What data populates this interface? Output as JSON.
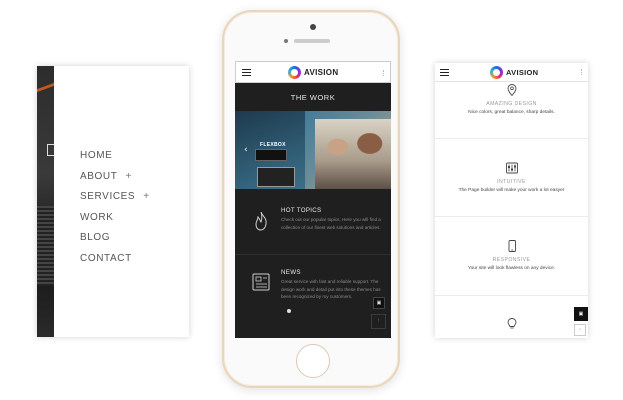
{
  "left_screen": {
    "menu": [
      {
        "label": "HOME",
        "expander": ""
      },
      {
        "label": "ABOUT",
        "expander": "+"
      },
      {
        "label": "SERVICES",
        "expander": "+"
      },
      {
        "label": "WORK",
        "expander": ""
      },
      {
        "label": "BLOG",
        "expander": ""
      },
      {
        "label": "CONTACT",
        "expander": ""
      }
    ]
  },
  "phone": {
    "brand": "AVISION",
    "section_title": "THE WORK",
    "slider": {
      "brand_text": "FLEXBOX",
      "prev_icon": "chevron-left-icon"
    },
    "features": [
      {
        "title": "HOT TOPICS",
        "text": "Check out our popular topics. Here you will find a collection of our finest web solutions and articles.",
        "icon": "flame-icon"
      },
      {
        "title": "NEWS",
        "text": "Great service with fast and reliable support. The design work and detail put into these themes has been recognized by my customers.",
        "icon": "newspaper-icon"
      }
    ],
    "back_to_top": "↑"
  },
  "right_screen": {
    "brand": "AVISION",
    "sections": [
      {
        "title": "AMAZING DESIGN",
        "text": "Nice colors, great balance, sharp details.",
        "icon": "location-pin-icon"
      },
      {
        "title": "INTUITIVE",
        "text": "The Page builder will make your work a lot easyer",
        "icon": "sliders-icon"
      },
      {
        "title": "RESPONSIVE",
        "text": "Your site will look flawless on any device.",
        "icon": "mobile-icon"
      },
      {
        "title": "",
        "text": "",
        "icon": "lightbulb-icon"
      }
    ],
    "back_to_top": "↑"
  },
  "colors": {
    "brand_dark": "#1f1f1f",
    "phone_frame": "#e9d7bd",
    "accent_gradient": "#8a2be2"
  }
}
